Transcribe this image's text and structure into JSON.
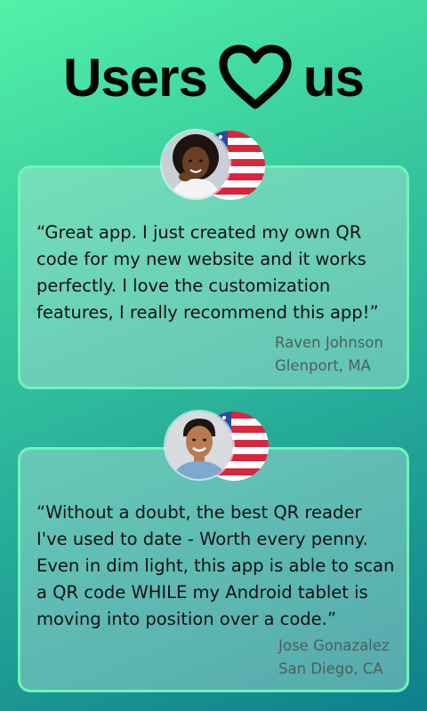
{
  "headline": {
    "word_before": "Users",
    "icon": "heart-outline-icon",
    "word_after": "us"
  },
  "testimonials": [
    {
      "quote": "“Great app. I just created my own QR code for my new website and it works perfectly. I love the customization features, I really recommend this app!”",
      "name": "Raven Johnson",
      "location": "Glenport, MA",
      "flag_icon": "usa-flag-icon",
      "avatar": "user-photo-woman"
    },
    {
      "quote": "“Without a doubt, the best QR reader I've used to date - Worth every penny. Even in dim light, this app is able to scan a QR code WHILE my Android tablet is moving into position over a code.”",
      "name": "Jose Gonazalez",
      "location": "San Diego, CA",
      "flag_icon": "usa-flag-icon",
      "avatar": "user-photo-man"
    }
  ],
  "colors": {
    "gradient_start": "#52f2a8",
    "gradient_end": "#0f7f8c",
    "card_border": "#6ff5b6",
    "headline_text": "#050505",
    "author_text": "#4d5e5c"
  }
}
